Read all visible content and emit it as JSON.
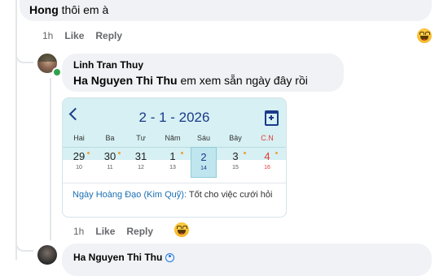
{
  "top_comment": {
    "author_tail": "Hong",
    "text": "thôi em à"
  },
  "actions1": {
    "time": "1h",
    "like": "Like",
    "reply": "Reply"
  },
  "reply1": {
    "author": "Linh Tran Thuy",
    "mention": "Ha Nguyen Thi Thu",
    "text": "em xem sẵn ngày đây rồi"
  },
  "calendar": {
    "back_icon": "chevron-left-icon",
    "date_title": "2 - 1 - 2026",
    "calendar_icon": "calendar-plus-icon",
    "weekdays": [
      "Hai",
      "Ba",
      "Tư",
      "Năm",
      "Sáu",
      "Bảy",
      "C.N"
    ],
    "days": [
      {
        "solar": "29",
        "lunar": "10"
      },
      {
        "solar": "30",
        "lunar": "11"
      },
      {
        "solar": "31",
        "lunar": "12"
      },
      {
        "solar": "1",
        "lunar": "13"
      },
      {
        "solar": "2",
        "lunar": "14"
      },
      {
        "solar": "3",
        "lunar": "15"
      },
      {
        "solar": "4",
        "lunar": "16"
      }
    ],
    "good_day_label": "Ngày Hoàng Đạo (Kim Quỹ):",
    "good_day_text": "Tốt cho việc cưới hỏi",
    "colors": {
      "header_bg": "#d6f0f3",
      "selected_bg": "#bfe6ee",
      "sunday": "#e53935",
      "accent": "#1b3a8a"
    }
  },
  "actions2": {
    "time": "1h",
    "like": "Like",
    "reply": "Reply"
  },
  "reply2": {
    "author": "Ha Nguyen Thi Thu",
    "badge_icon": "author-badge-icon"
  }
}
